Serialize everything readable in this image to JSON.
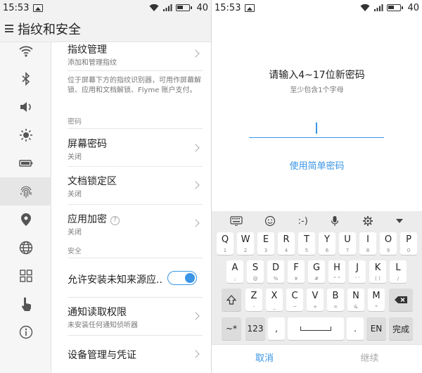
{
  "left": {
    "status": {
      "time": "15:53",
      "battery": "40"
    },
    "header": {
      "title": "指纹和安全"
    },
    "rail_icons": [
      "wifi-icon",
      "bluetooth-icon",
      "volume-icon",
      "brightness-icon",
      "battery-icon",
      "fingerprint-icon",
      "location-icon",
      "globe-icon",
      "apps-grid-icon",
      "touch-icon",
      "info-icon"
    ],
    "fingerprint": {
      "title": "指纹管理",
      "subtitle": "添加和管理指纹"
    },
    "description": "位于屏幕下方的指纹识别器，可用作屏幕解锁、应用和文档解锁、Flyme 账户支付。",
    "section_password": "密码",
    "screen_password": {
      "title": "屏幕密码",
      "subtitle": "关闭"
    },
    "doc_lock": {
      "title": "文档锁定区",
      "subtitle": "关闭"
    },
    "app_encrypt": {
      "title": "应用加密",
      "subtitle": "关闭",
      "help": "?"
    },
    "section_security": "安全",
    "unknown_sources": {
      "title": "允许安装未知来源应..",
      "enabled": true
    },
    "notification_access": {
      "title": "通知读取权限",
      "subtitle": "未安装任何通知侦听器"
    },
    "device_admin": {
      "title": "设备管理与凭证"
    }
  },
  "right": {
    "status": {
      "time": "15:53",
      "battery": "40"
    },
    "prompt_title": "请输入4~17位新密码",
    "prompt_subtitle": "至少包含1个字母",
    "simple_password_link": "使用简单密码",
    "keyboard": {
      "toolbar": [
        "keyboard-icon",
        "emoji-icon",
        ":-)",
        "mic-icon",
        "settings-icon",
        "collapse-icon"
      ],
      "emoticon": ":-)",
      "row1": [
        {
          "k": "Q",
          "a": "1"
        },
        {
          "k": "W",
          "a": "2"
        },
        {
          "k": "E",
          "a": "3"
        },
        {
          "k": "R",
          "a": "4"
        },
        {
          "k": "T",
          "a": "5"
        },
        {
          "k": "Y",
          "a": "6"
        },
        {
          "k": "U",
          "a": "7"
        },
        {
          "k": "I",
          "a": "8"
        },
        {
          "k": "O",
          "a": "9"
        },
        {
          "k": "P",
          "a": "0"
        }
      ],
      "row2": [
        {
          "k": "A",
          "a": ";"
        },
        {
          "k": "S",
          "a": "@"
        },
        {
          "k": "D",
          "a": "%"
        },
        {
          "k": "F",
          "a": "¥"
        },
        {
          "k": "G",
          "a": "#"
        },
        {
          "k": "H",
          "a": "\" \""
        },
        {
          "k": "J",
          "a": "' '"
        },
        {
          "k": "K",
          "a": "( )"
        },
        {
          "k": "L",
          "a": "/"
        }
      ],
      "row3": [
        {
          "k": "Z",
          "a": "-"
        },
        {
          "k": "X",
          "a": "_"
        },
        {
          "k": "C",
          "a": "~"
        },
        {
          "k": "V",
          "a": "+"
        },
        {
          "k": "B",
          "a": "="
        },
        {
          "k": "N",
          "a": "&"
        },
        {
          "k": "M",
          "a": "*"
        }
      ],
      "sym_key": "~*",
      "num_key": "123",
      "comma": ",",
      "period": ".",
      "lang": "EN",
      "done": "完成"
    },
    "cancel": "取消",
    "next": "继续"
  }
}
